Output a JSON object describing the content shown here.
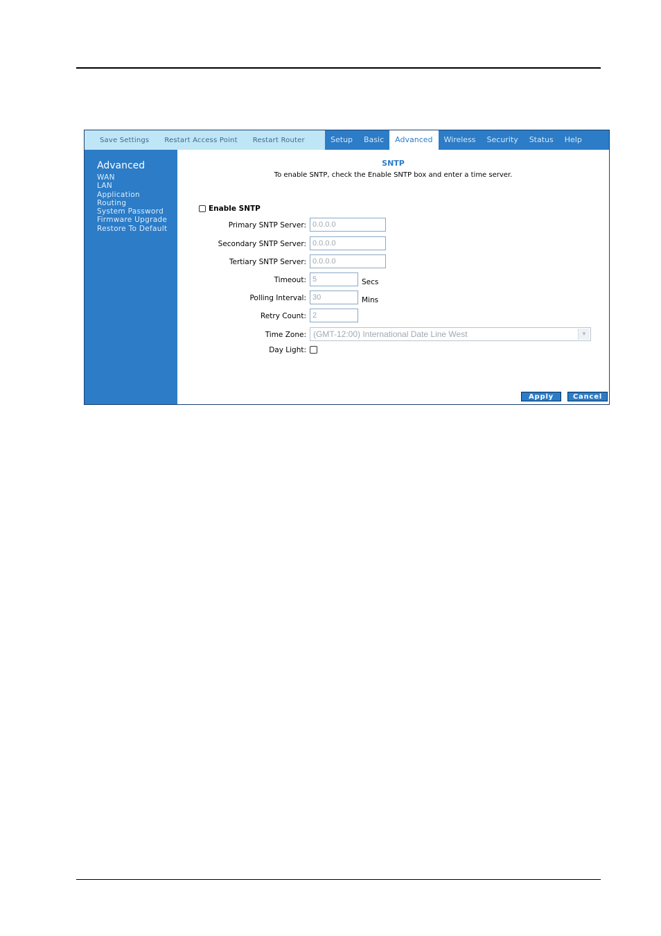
{
  "utility_links": [
    "Save Settings",
    "Restart Access Point",
    "Restart Router"
  ],
  "tabs": [
    "Setup",
    "Basic",
    "Advanced",
    "Wireless",
    "Security",
    "Status",
    "Help"
  ],
  "sidebar": {
    "title": "Advanced",
    "items": [
      "WAN",
      "LAN",
      "Application",
      "Routing",
      "System Password",
      "Firmware Upgrade",
      "Restore To Default"
    ]
  },
  "page": {
    "title": "SNTP",
    "description": "To enable SNTP, check the Enable SNTP box and enter a time server.",
    "enable_label": "Enable SNTP"
  },
  "form": {
    "primary": {
      "label": "Primary SNTP Server:",
      "value": "0.0.0.0"
    },
    "secondary": {
      "label": "Secondary SNTP Server:",
      "value": "0.0.0.0"
    },
    "tertiary": {
      "label": "Tertiary SNTP Server:",
      "value": "0.0.0.0"
    },
    "timeout": {
      "label": "Timeout:",
      "value": "5",
      "unit": "Secs"
    },
    "polling": {
      "label": "Polling Interval:",
      "value": "30",
      "unit": "Mins"
    },
    "retry": {
      "label": "Retry Count:",
      "value": "2"
    },
    "timezone": {
      "label": "Time Zone:",
      "value": "(GMT-12:00) International Date Line West"
    },
    "daylight": {
      "label": "Day Light:"
    }
  },
  "buttons": {
    "apply": "Apply",
    "cancel": "Cancel"
  },
  "colors": {
    "accent": "#2c7cc7",
    "utility_bar": "#bfe6f6"
  }
}
